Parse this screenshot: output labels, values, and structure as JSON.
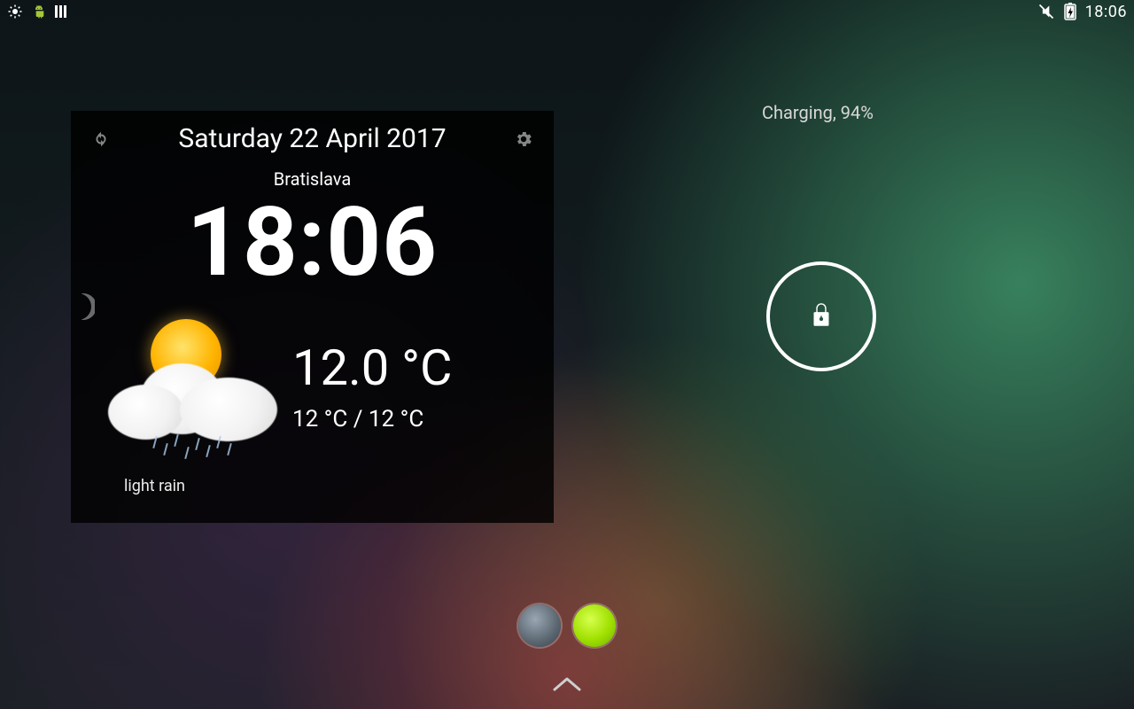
{
  "status_bar": {
    "time": "18:06"
  },
  "charging": {
    "text": "Charging, 94%"
  },
  "widget": {
    "date": "Saturday 22 April 2017",
    "location": "Bratislava",
    "clock": "18:06",
    "temp_main": "12.0 °C",
    "temp_range": "12 °C / 12 °C",
    "condition": "light rain"
  }
}
